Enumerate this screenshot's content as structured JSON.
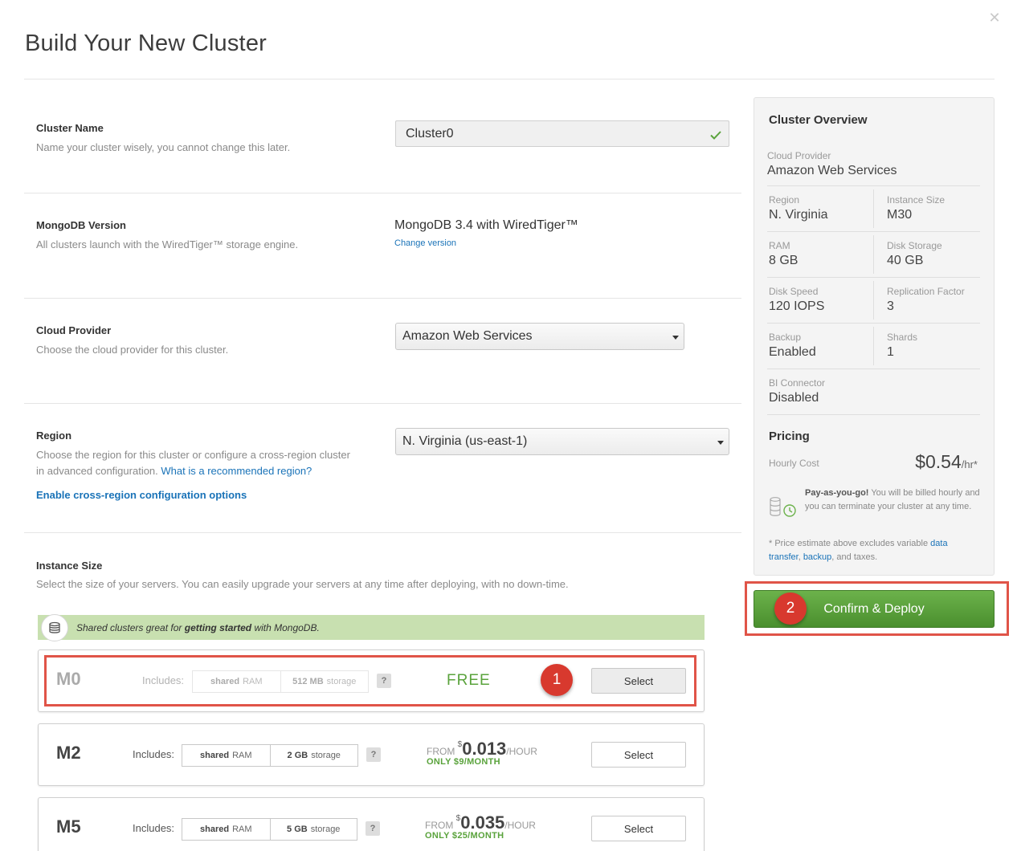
{
  "page": {
    "title": "Build Your New Cluster",
    "close_icon": "close-icon"
  },
  "sections": {
    "cluster_name": {
      "label": "Cluster Name",
      "desc": "Name your cluster wisely, you cannot change this later.",
      "value": "Cluster0"
    },
    "mongodb_version": {
      "label": "MongoDB Version",
      "desc": "All clusters launch with the WiredTiger™ storage engine.",
      "value": "MongoDB 3.4 with WiredTiger™",
      "change_link": "Change version"
    },
    "cloud_provider": {
      "label": "Cloud Provider",
      "desc": "Choose the cloud provider for this cluster.",
      "selected": "Amazon Web Services"
    },
    "region": {
      "label": "Region",
      "desc_line1": "Choose the region for this cluster or configure a cross-region cluster",
      "desc_line2": "in advanced configuration.",
      "link": "What is a recommended region?",
      "cross_region_link": "Enable cross-region configuration options",
      "selected": "N. Virginia (us-east-1)"
    },
    "instance_size": {
      "label": "Instance Size",
      "desc": "Select the size of your servers. You can easily upgrade your servers at any time after deploying, with no down-time."
    }
  },
  "shared_banner": {
    "pre": "Shared clusters great for ",
    "bold": "getting started",
    "post": " with MongoDB."
  },
  "tiers": [
    {
      "name": "M0",
      "includes": "Includes:",
      "ram_bold": "shared",
      "ram_unit": "RAM",
      "storage_bold": "512 MB",
      "storage_unit": "storage",
      "help": "?",
      "price_label": "FREE",
      "select": "Select"
    },
    {
      "name": "M2",
      "includes": "Includes:",
      "ram_bold": "shared",
      "ram_unit": "RAM",
      "storage_bold": "2 GB",
      "storage_unit": "storage",
      "help": "?",
      "from": "FROM",
      "currency": "$",
      "amount": "0.013",
      "per": "/HOUR",
      "monthly": "ONLY $9/MONTH",
      "select": "Select"
    },
    {
      "name": "M5",
      "includes": "Includes:",
      "ram_bold": "shared",
      "ram_unit": "RAM",
      "storage_bold": "5 GB",
      "storage_unit": "storage",
      "help": "?",
      "from": "FROM",
      "currency": "$",
      "amount": "0.035",
      "per": "/HOUR",
      "monthly": "ONLY $25/MONTH",
      "select": "Select"
    }
  ],
  "callouts": {
    "one": "1",
    "two": "2",
    "color": "#d8392e"
  },
  "overview": {
    "title": "Cluster Overview",
    "cloud_provider": {
      "key": "Cloud Provider",
      "val": "Amazon Web Services"
    },
    "region": {
      "key": "Region",
      "val": "N. Virginia"
    },
    "instance_size": {
      "key": "Instance Size",
      "val": "M30"
    },
    "ram": {
      "key": "RAM",
      "val": "8 GB"
    },
    "disk_storage": {
      "key": "Disk Storage",
      "val": "40 GB"
    },
    "disk_speed": {
      "key": "Disk Speed",
      "val": "120 IOPS"
    },
    "replication": {
      "key": "Replication Factor",
      "val": "3"
    },
    "backup": {
      "key": "Backup",
      "val": "Enabled"
    },
    "shards": {
      "key": "Shards",
      "val": "1"
    },
    "bi_connector": {
      "key": "BI Connector",
      "val": "Disabled"
    },
    "pricing_title": "Pricing",
    "hourly_key": "Hourly Cost",
    "hourly_val": "$0.54",
    "hourly_unit": "/hr*",
    "payg_bold": "Pay-as-you-go!",
    "payg_text": " You will be billed hourly and you can terminate your cluster at any time.",
    "footnote_pre": "* Price estimate above excludes variable ",
    "footnote_link1": "data transfer",
    "footnote_link2": "backup",
    "footnote_post": ", and taxes."
  },
  "confirm_button": "Confirm & Deploy",
  "colors": {
    "accent_green": "#5aa33c",
    "link_blue": "#1a73b8",
    "callout_red": "#e05448"
  }
}
